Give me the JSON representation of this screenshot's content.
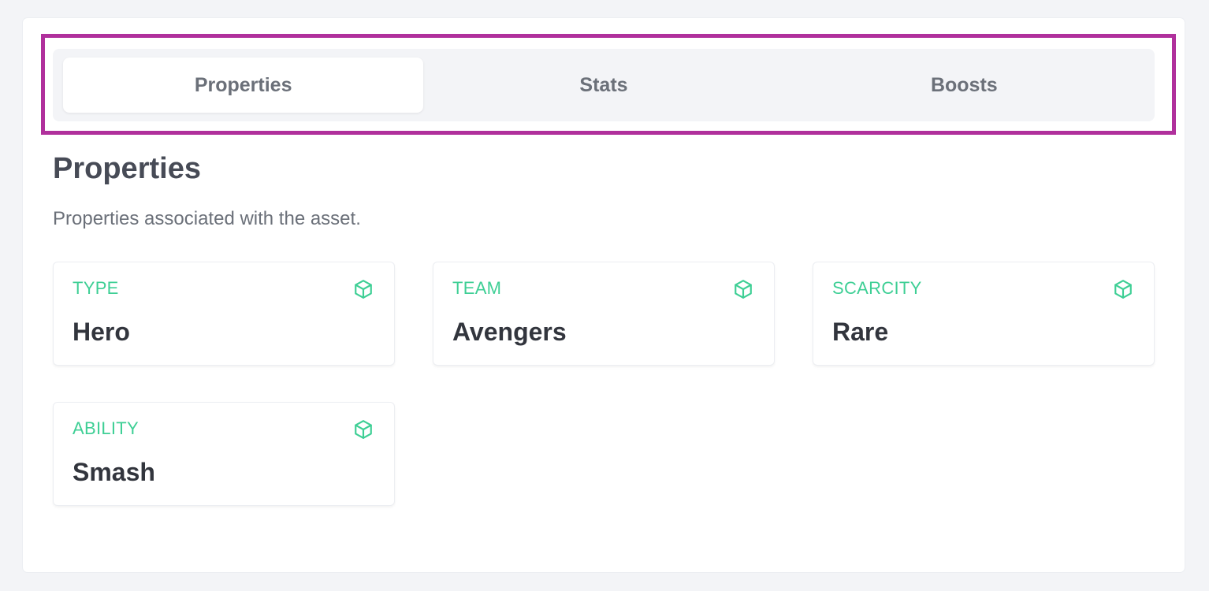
{
  "tabs": [
    {
      "label": "Properties",
      "active": true
    },
    {
      "label": "Stats",
      "active": false
    },
    {
      "label": "Boosts",
      "active": false
    }
  ],
  "section": {
    "title": "Properties",
    "description": "Properties associated with the asset."
  },
  "properties": [
    {
      "label": "TYPE",
      "value": "Hero",
      "icon": "cube-icon"
    },
    {
      "label": "TEAM",
      "value": "Avengers",
      "icon": "cube-icon"
    },
    {
      "label": "SCARCITY",
      "value": "Rare",
      "icon": "cube-icon"
    },
    {
      "label": "ABILITY",
      "value": "Smash",
      "icon": "cube-icon"
    }
  ],
  "colors": {
    "accent": "#3ecf95",
    "highlight_border": "#b0309c",
    "title_text": "#474b56",
    "muted_text": "#6b7079"
  }
}
